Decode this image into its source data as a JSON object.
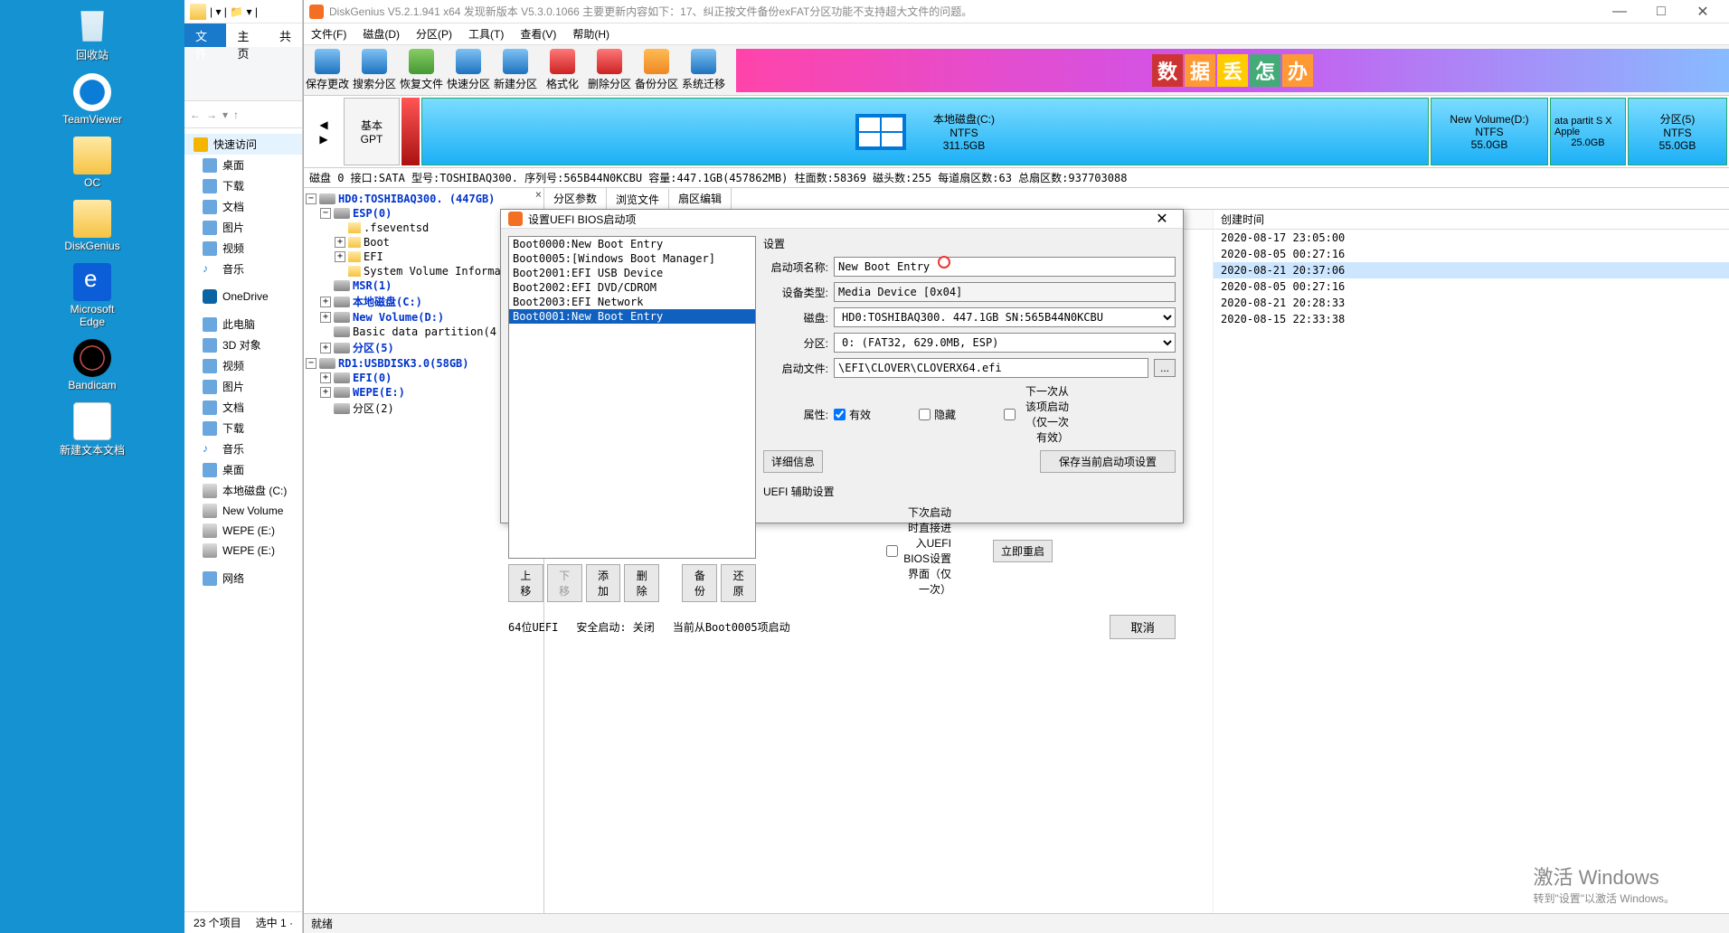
{
  "desktop": {
    "icons": [
      {
        "label": "回收站",
        "cls": "recycle"
      },
      {
        "label": "TeamViewer",
        "cls": "tv"
      },
      {
        "label": "OC",
        "cls": "folder"
      },
      {
        "label": "DiskGenius",
        "cls": "folder"
      },
      {
        "label": "Microsoft Edge",
        "cls": "edge"
      },
      {
        "label": "Bandicam",
        "cls": "bandi"
      },
      {
        "label": "新建文本文档",
        "cls": "doc"
      }
    ]
  },
  "explorer": {
    "tab_file": "文件",
    "tab_home": "主页",
    "tab_share": "共",
    "back": "←",
    "fwd": "→",
    "up": "↑",
    "quick": "快速访问",
    "items": [
      "桌面",
      "下载",
      "文档",
      "图片",
      "视频",
      "音乐"
    ],
    "onedrive": "OneDrive",
    "thispc": "此电脑",
    "pcitems": [
      "3D 对象",
      "视频",
      "图片",
      "文档",
      "下载",
      "音乐",
      "桌面",
      "本地磁盘 (C:)",
      "New Volume",
      "WEPE (E:)",
      "WEPE (E:)",
      "网络"
    ],
    "status_count": "23 个项目",
    "status_sel": "选中 1 ·"
  },
  "dg": {
    "title": "DiskGenius V5.2.1.941 x64    发现新版本 V5.3.0.1066 主要更新内容如下：17、纠正按文件备份exFAT分区功能不支持超大文件的问题。",
    "menu": [
      "文件(F)",
      "磁盘(D)",
      "分区(P)",
      "工具(T)",
      "查看(V)",
      "帮助(H)"
    ],
    "tools": [
      {
        "l": "保存更改",
        "c": ""
      },
      {
        "l": "搜索分区",
        "c": ""
      },
      {
        "l": "恢复文件",
        "c": "grn"
      },
      {
        "l": "快速分区",
        "c": ""
      },
      {
        "l": "新建分区",
        "c": ""
      },
      {
        "l": "格式化",
        "c": "red"
      },
      {
        "l": "删除分区",
        "c": "red"
      },
      {
        "l": "备份分区",
        "c": "org"
      },
      {
        "l": "系统迁移",
        "c": ""
      }
    ],
    "banner_chars": [
      "数",
      "据",
      "丢",
      "怎",
      "办"
    ],
    "disk_sel": {
      "l1": "基本",
      "l2": "GPT"
    },
    "parts": [
      {
        "name": "本地磁盘(C:)",
        "fs": "NTFS",
        "size": "311.5GB",
        "cls": "c"
      },
      {
        "name": "New Volume(D:)",
        "fs": "NTFS",
        "size": "55.0GB",
        "w": "130"
      },
      {
        "name": "ata partit S X Apple",
        "fs": "",
        "size": "25.0GB",
        "w": "84"
      },
      {
        "name": "分区(5)",
        "fs": "NTFS",
        "size": "55.0GB",
        "w": "110"
      }
    ],
    "diskinfo": "磁盘 0  接口:SATA  型号:TOSHIBAQ300.  序列号:565B44N0KCBU  容量:447.1GB(457862MB)  柱面数:58369  磁头数:255  每道扇区数:63  总扇区数:937703088",
    "tabs": [
      "分区参数",
      "浏览文件",
      "扇区编辑"
    ],
    "tree": {
      "hd0": "HD0:TOSHIBAQ300. (447GB)",
      "esp": "ESP(0)",
      "fse": ".fseventsd",
      "boot": "Boot",
      "efi": "EFI",
      "svi": "System Volume Informat:",
      "msr": "MSR(1)",
      "c": "本地磁盘(C:)",
      "d": "New Volume(D:)",
      "bdp": "Basic data partition(4",
      "p5": "分区(5)",
      "rd1": "RD1:USBDISK3.0(58GB)",
      "efi0": "EFI(0)",
      "wepe": "WEPE(E:)",
      "p2": "分区(2)"
    },
    "filecol_hdr": "",
    "time_hdr": "创建时间",
    "times": [
      "2020-08-17 23:05:00",
      "2020-08-05 00:27:16",
      "2020-08-21 20:37:06",
      "2020-08-05 00:27:16",
      "2020-08-21 20:28:33",
      "2020-08-15 22:33:38"
    ],
    "status": "就绪"
  },
  "dialog": {
    "title": "设置UEFI BIOS启动项",
    "bootlist": [
      "Boot0000:New Boot Entry",
      "Boot0005:[Windows Boot Manager]",
      "Boot2001:EFI USB Device",
      "Boot2002:EFI DVD/CDROM",
      "Boot2003:EFI Network",
      "Boot0001:New Boot Entry"
    ],
    "btns": {
      "up": "上移",
      "down": "下移",
      "add": "添加",
      "del": "删除",
      "backup": "备份",
      "restore": "还原"
    },
    "settings": "设置",
    "lbl_name": "启动项名称:",
    "val_name": "New Boot Entry",
    "lbl_type": "设备类型:",
    "val_type": "Media Device [0x04]",
    "lbl_disk": "磁盘:",
    "val_disk": "HD0:TOSHIBAQ300. 447.1GB SN:565B44N0KCBU",
    "lbl_part": "分区:",
    "val_part": "0: (FAT32, 629.0MB, ESP)",
    "lbl_file": "启动文件:",
    "val_file": "\\EFI\\CLOVER\\CLOVERX64.efi",
    "lbl_attr": "属性:",
    "chk_valid": "有效",
    "chk_hidden": "隐藏",
    "chk_once": "下一次从该项启动（仅一次有效）",
    "btn_detail": "详细信息",
    "btn_save": "保存当前启动项设置",
    "aux_title": "UEFI 辅助设置",
    "chk_aux": "下次启动时直接进入UEFI BIOS设置界面（仅一次）",
    "btn_reboot": "立即重启",
    "footer_bits": "64位UEFI",
    "footer_secure": "安全启动: 关闭",
    "footer_current": "当前从Boot0005项启动",
    "btn_cancel": "取消"
  },
  "watermark": {
    "l1": "激活 Windows",
    "l2": "转到\"设置\"以激活 Windows。"
  }
}
